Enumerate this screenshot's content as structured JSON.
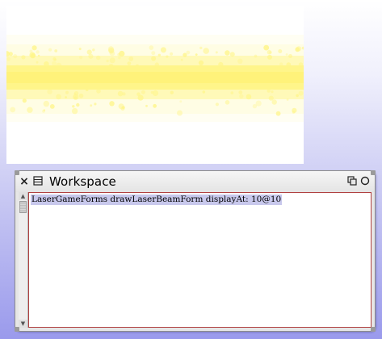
{
  "laser_form": {
    "icon": "laser-beam-image",
    "colors": {
      "background": "#ffffff",
      "outer_glow": "#fffde4",
      "mid_glow": "#fff9b8",
      "core": "#fff37a",
      "dots": "#fff58c"
    }
  },
  "workspace": {
    "title": "Workspace",
    "code": "LaserGameForms drawLaserBeamForm displayAt: 10@10",
    "icons": {
      "close": "close-icon",
      "menu": "window-menu-icon",
      "collapse": "collapse-icon",
      "expand": "expand-icon"
    },
    "colors": {
      "selection": "#c8c8ec",
      "pane_border": "#b04040",
      "window": "#e6e6e6"
    }
  }
}
